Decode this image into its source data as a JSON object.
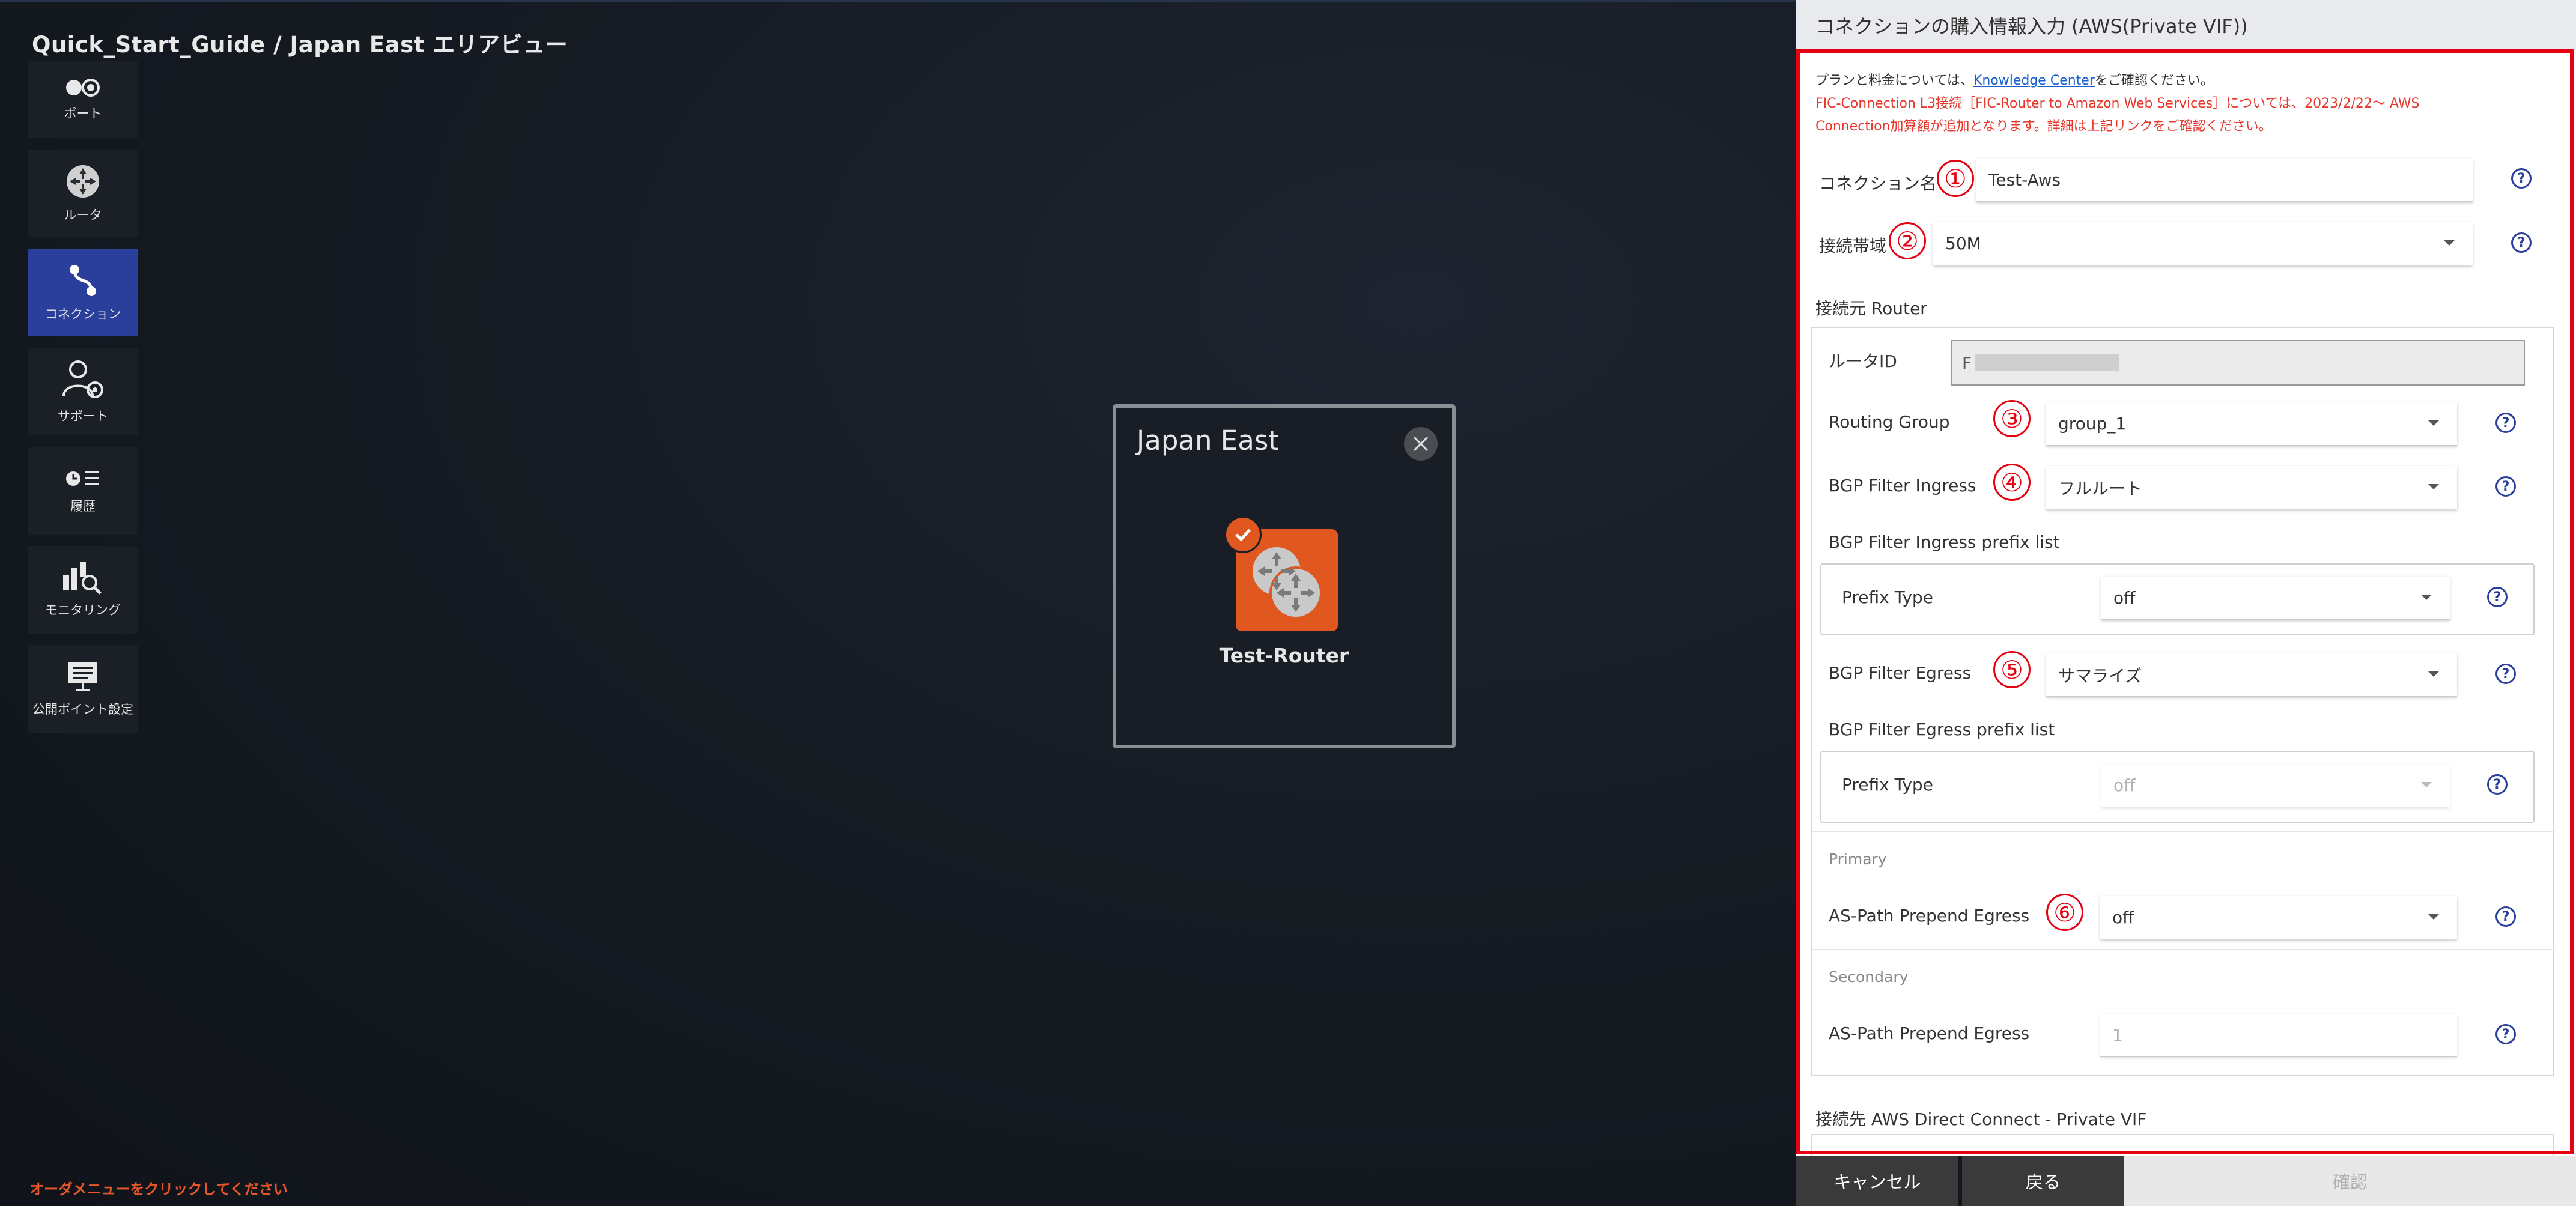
{
  "breadcrumb": "Quick_Start_Guide / Japan East エリアビュー",
  "sidebar": {
    "items": [
      {
        "label": "ポート",
        "icon": "port-icon"
      },
      {
        "label": "ルータ",
        "icon": "router-icon"
      },
      {
        "label": "コネクション",
        "icon": "connection-icon",
        "active": true
      },
      {
        "label": "サポート",
        "icon": "support-icon"
      },
      {
        "label": "履歴",
        "icon": "history-icon"
      },
      {
        "label": "モニタリング",
        "icon": "monitoring-icon"
      },
      {
        "label": "公開ポイント設定",
        "icon": "public-point-icon"
      }
    ]
  },
  "status_message": "オーダメニューをクリックしてください",
  "area_modal": {
    "title": "Japan East",
    "router_name": "Test-Router"
  },
  "panel": {
    "title": "コネクションの購入情報入力 (AWS(Private VIF))",
    "note_prefix": "プランと料金については、",
    "note_link": "Knowledge Center",
    "note_suffix": "をご確認ください。",
    "warning_line1": "FIC-Connection L3接続［FIC-Router to Amazon Web Services］については、2023/2/22～ AWS",
    "warning_line2": "Connection加算額が追加となります。詳細は上記リンクをご確認ください。",
    "connection_name": {
      "label": "コネクション名",
      "value": "Test-Aws",
      "marker": "①"
    },
    "bandwidth": {
      "label": "接続帯域",
      "value": "50M",
      "marker": "②"
    },
    "source_router_heading": "接続元 Router",
    "router_id": {
      "label": "ルータID",
      "value": "F"
    },
    "routing_group": {
      "label": "Routing Group",
      "value": "group_1",
      "marker": "③"
    },
    "bgp_ingress": {
      "label": "BGP Filter Ingress",
      "value": "フルルート",
      "marker": "④"
    },
    "ingress_prefix_heading": "BGP Filter Ingress prefix list",
    "ingress_prefix_type": {
      "label": "Prefix Type",
      "value": "off"
    },
    "bgp_egress": {
      "label": "BGP Filter Egress",
      "value": "サマライズ",
      "marker": "⑤"
    },
    "egress_prefix_heading": "BGP Filter Egress prefix list",
    "egress_prefix_type": {
      "label": "Prefix Type",
      "value": "off"
    },
    "primary_heading": "Primary",
    "primary_as_path": {
      "label": "AS-Path Prepend Egress",
      "value": "off",
      "marker": "⑥"
    },
    "secondary_heading": "Secondary",
    "secondary_as_path": {
      "label": "AS-Path Prepend Egress",
      "value": "1"
    },
    "dest_heading": "接続先 AWS Direct Connect - Private VIF",
    "help_symbol": "?"
  },
  "footer": {
    "cancel_label": "キャンセル",
    "back_label": "戻る",
    "confirm_label": "確認"
  },
  "colors": {
    "accent_active": "#2a3f9c",
    "highlight_border": "#e60012",
    "router_orange": "#e0571f",
    "warning_text": "#e8362a"
  }
}
